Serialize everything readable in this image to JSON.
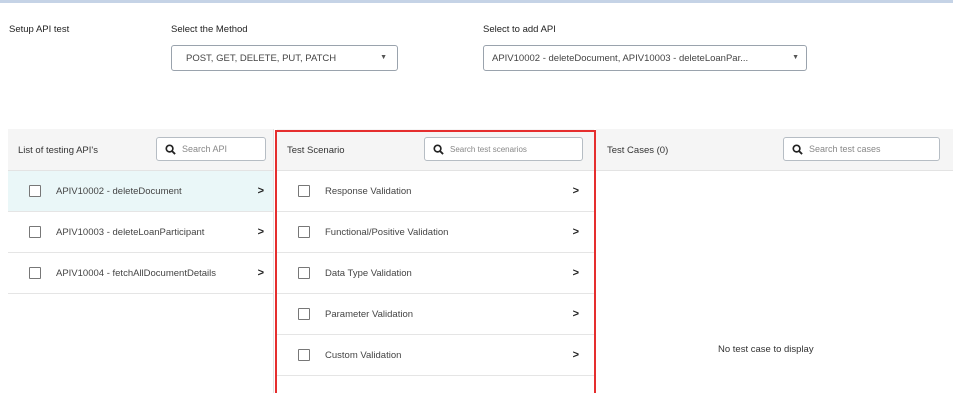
{
  "setup": {
    "label": "Setup API test",
    "method_label": "Select the Method",
    "method_value": "POST, GET, DELETE, PUT, PATCH",
    "api_label": "Select to add API",
    "api_value": "APIV10002 - deleteDocument, APIV10003 - deleteLoanPar..."
  },
  "icons": {
    "caret": "caret-down-icon",
    "search": "search-icon",
    "chevron": "chevron-right-icon",
    "checkbox": "checkbox-icon"
  },
  "apis_panel": {
    "title": "List of testing API's",
    "search_placeholder": "Search API",
    "items": [
      {
        "label": "APIV10002 - deleteDocument",
        "selected": true
      },
      {
        "label": "APIV10003 - deleteLoanParticipant",
        "selected": false
      },
      {
        "label": "APIV10004 - fetchAllDocumentDetails",
        "selected": false
      }
    ]
  },
  "scenario_panel": {
    "title": "Test Scenario",
    "search_placeholder": "Search test scenarios",
    "items": [
      {
        "label": "Response Validation"
      },
      {
        "label": "Functional/Positive Validation"
      },
      {
        "label": "Data Type Validation"
      },
      {
        "label": "Parameter Validation"
      },
      {
        "label": "Custom Validation"
      }
    ]
  },
  "cases_panel": {
    "title": "Test Cases (0)",
    "search_placeholder": "Search test cases",
    "empty_text": "No test case to display"
  },
  "colors": {
    "highlight_frame": "#e52e2e",
    "selected_row": "#eaf7f8",
    "header_bg": "#f5f5f5"
  }
}
